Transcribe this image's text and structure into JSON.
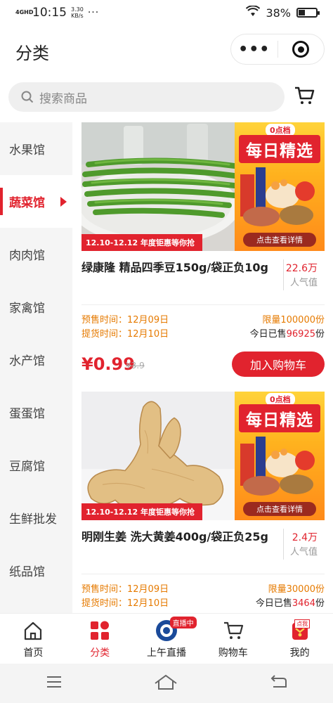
{
  "status": {
    "network": "4GHD",
    "time": "10:15",
    "speed_value": "3.30",
    "speed_unit": "KB/s",
    "dots": "···",
    "battery": "38%",
    "battery_level": 0.38
  },
  "header": {
    "title": "分类",
    "more": "•••"
  },
  "search": {
    "placeholder": "搜索商品"
  },
  "sidebar": {
    "items": [
      {
        "label": "水果馆",
        "active": false
      },
      {
        "label": "蔬菜馆",
        "active": true
      },
      {
        "label": "肉肉馆",
        "active": false
      },
      {
        "label": "家禽馆",
        "active": false
      },
      {
        "label": "水产馆",
        "active": false
      },
      {
        "label": "蛋蛋馆",
        "active": false
      },
      {
        "label": "豆腐馆",
        "active": false
      },
      {
        "label": "生鲜批发",
        "active": false
      },
      {
        "label": "纸品馆",
        "active": false
      }
    ]
  },
  "products": [
    {
      "name": "绿康隆 精品四季豆150g/袋正负10g",
      "popularity": "22.6万",
      "popularity_label": "人气值",
      "presale": "预售时间：12月09日",
      "pickup": "提货时间：12月10日",
      "limit": "限量100000份",
      "sold_prefix": "今日已售",
      "sold_count": "96925",
      "sold_suffix": "份",
      "price": "¥0.99",
      "original_price": "¥3.9",
      "add_cart": "加入购物车",
      "banner": {
        "ribbon": "12.10-12.12 年度钜惠等你抢",
        "tag": "0点档",
        "headline": "每日精选",
        "detail": "点击查看详情"
      }
    },
    {
      "name": "明刚生姜 洗大黄姜400g/袋正负25g",
      "popularity": "2.4万",
      "popularity_label": "人气值",
      "presale": "预售时间：12月09日",
      "pickup": "提货时间：12月10日",
      "limit": "限量30000份",
      "sold_prefix": "今日已售",
      "sold_count": "3464",
      "sold_suffix": "份",
      "price": "",
      "original_price": "",
      "add_cart": "",
      "banner": {
        "ribbon": "12.10-12.12 年度钜惠等你抢",
        "tag": "0点档",
        "headline": "每日精选",
        "detail": "点击查看详情"
      }
    }
  ],
  "tabbar": {
    "items": [
      {
        "label": "首页",
        "icon": "home-icon",
        "active": false
      },
      {
        "label": "分类",
        "icon": "category-icon",
        "active": true
      },
      {
        "label": "上午直播",
        "icon": "live-icon",
        "active": false,
        "badge": "直播中"
      },
      {
        "label": "购物车",
        "icon": "cart-icon",
        "active": false
      },
      {
        "label": "我的",
        "icon": "profile-icon",
        "active": false,
        "badge": "点我"
      }
    ]
  },
  "colors": {
    "accent": "#e1232e",
    "orange": "#e67a00"
  }
}
